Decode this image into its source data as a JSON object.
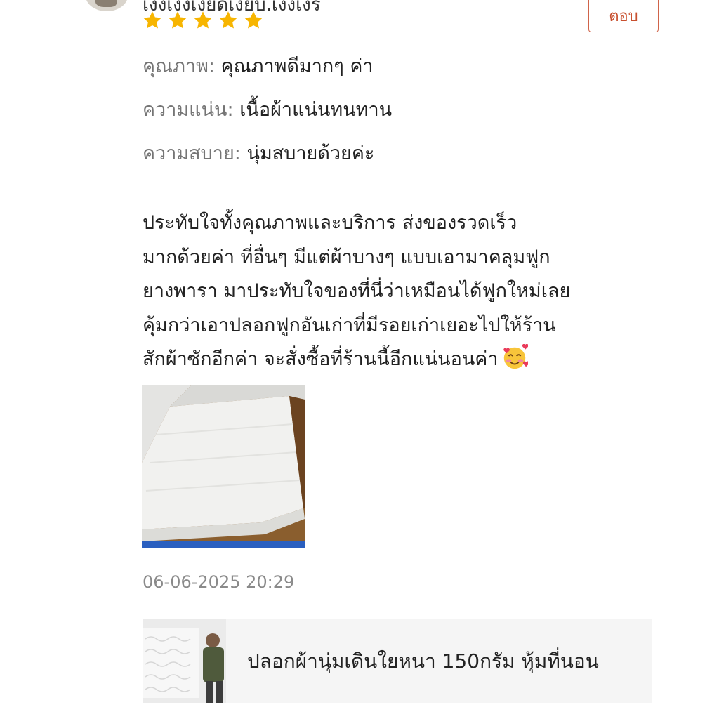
{
  "review": {
    "username": "เง็งเง็งเงียดเงียบ.เงงเงิร",
    "reply_label": "ตอบ",
    "rating": 5,
    "attributes": [
      {
        "label": "คุณภาพ:",
        "value": "คุณภาพดีมากๆ ค่า"
      },
      {
        "label": "ความแน่น:",
        "value": "เนื้อผ้าแน่นทนทาน"
      },
      {
        "label": "ความสบาย:",
        "value": "นุ่มสบายด้วยค่ะ"
      }
    ],
    "comment_lines": [
      "ประทับใจทั้งคุณภาพและบริการ ส่งของรวดเร็ว",
      "มากด้วยค่า ที่อื่นๆ มีแต่ผ้าบางๆ แบบเอามาคลุมฟูก",
      "ยางพารา มาประทับใจของที่นี่ว่าเหมือนได้ฟูกใหม่เลย",
      "คุ้มกว่าเอาปลอกฟูกอันเก่าที่มีรอยเก่าเยอะไปให้ร้าน",
      "สักผ้าซักอีกค่า จะสั่งซื้อที่ร้านนี้อีกแน่นอนค่า"
    ],
    "emoji_icon": "smiling-face-with-hearts-icon",
    "timestamp": "06-06-2025 20:29"
  },
  "product": {
    "title": "ปลอกผ้านุ่มเดินใยหนา 150กรัม หุ้มที่นอน"
  },
  "colors": {
    "star": "#f7b500",
    "reply_border": "#d0644a",
    "muted_text": "#757575",
    "product_bg": "#f5f5f5"
  }
}
